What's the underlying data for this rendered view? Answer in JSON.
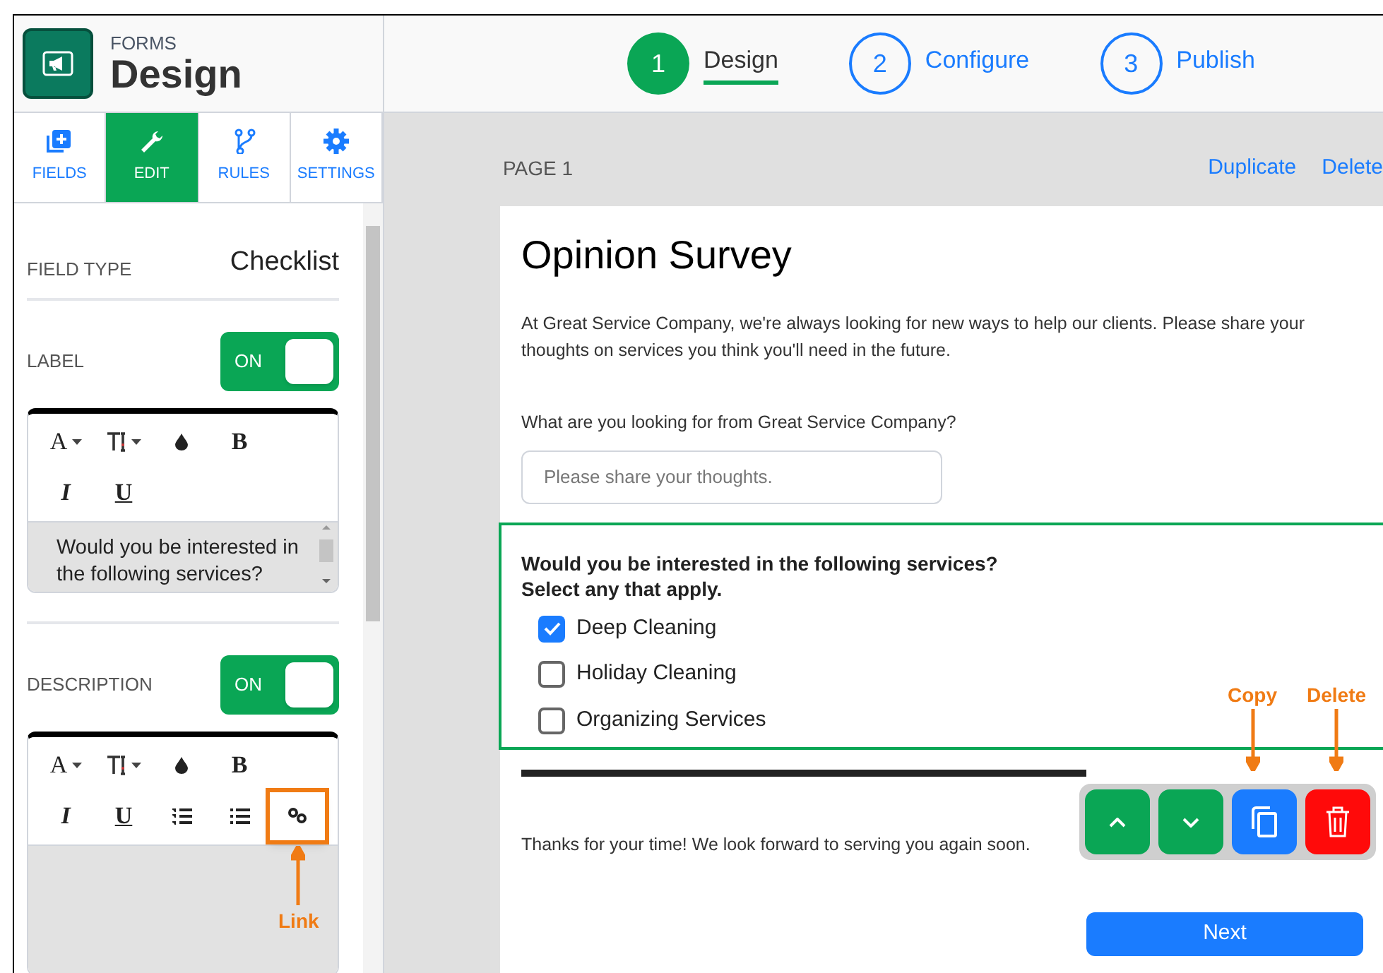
{
  "app": {
    "section": "FORMS",
    "title": "Design"
  },
  "steps": [
    {
      "number": "1",
      "label": "Design",
      "selected": true
    },
    {
      "number": "2",
      "label": "Configure",
      "selected": false
    },
    {
      "number": "3",
      "label": "Publish",
      "selected": false
    }
  ],
  "sidebar_tabs": [
    {
      "label": "FIELDS",
      "kind": "fields",
      "selected": false
    },
    {
      "label": "EDIT",
      "kind": "edit",
      "selected": true
    },
    {
      "label": "RULES",
      "kind": "rules",
      "selected": false
    },
    {
      "label": "SETTINGS",
      "kind": "settings",
      "selected": false
    }
  ],
  "field_type": {
    "label": "FIELD TYPE",
    "value": "Checklist"
  },
  "sections": [
    {
      "label": "LABEL",
      "toggle": {
        "text": "ON",
        "on": true
      },
      "tools": [
        {
          "kind": "font",
          "text": "A"
        },
        {
          "kind": "size"
        },
        {
          "kind": "color"
        },
        {
          "kind": "bold",
          "text": "B"
        },
        {
          "kind": "italic",
          "text": "I"
        },
        {
          "kind": "underline",
          "text": "U"
        }
      ],
      "value": "Would you be interested in the following services?"
    },
    {
      "label": "DESCRIPTION",
      "toggle": {
        "text": "ON",
        "on": true
      },
      "tools": [
        {
          "kind": "font",
          "text": "A"
        },
        {
          "kind": "size"
        },
        {
          "kind": "color"
        },
        {
          "kind": "bold",
          "text": "B"
        },
        {
          "kind": "italic",
          "text": "I"
        },
        {
          "kind": "underline",
          "text": "U"
        },
        {
          "kind": "ordered"
        },
        {
          "kind": "bullets"
        },
        {
          "kind": "link",
          "highlighted": true
        }
      ]
    }
  ],
  "page": {
    "label": "PAGE 1",
    "actions": [
      "Duplicate",
      "Delete"
    ]
  },
  "form": {
    "title": "Opinion Survey",
    "intro": "At Great Service Company, we're always looking for new ways to help our clients. Please share your thoughts on services you think you'll need in the future.",
    "question": "What are you looking for from Great Service Company?",
    "placeholder": "Please share your thoughts.",
    "checklist": {
      "label": "Would you be interested in the following services?",
      "description": "Select any that apply.",
      "options": [
        {
          "label": "Deep Cleaning",
          "checked": true
        },
        {
          "label": "Holiday Cleaning",
          "checked": false
        },
        {
          "label": "Organizing Services",
          "checked": false
        }
      ]
    },
    "field_actions": [
      {
        "kind": "up"
      },
      {
        "kind": "down"
      },
      {
        "kind": "copy"
      },
      {
        "kind": "delete"
      }
    ],
    "thanks": "Thanks for your time! We look forward to serving you again soon.",
    "next": "Next"
  },
  "annotations": [
    {
      "text": "Link",
      "kind": "link"
    },
    {
      "text": "Copy",
      "kind": "copy"
    },
    {
      "text": "Delete",
      "kind": "delete"
    }
  ]
}
